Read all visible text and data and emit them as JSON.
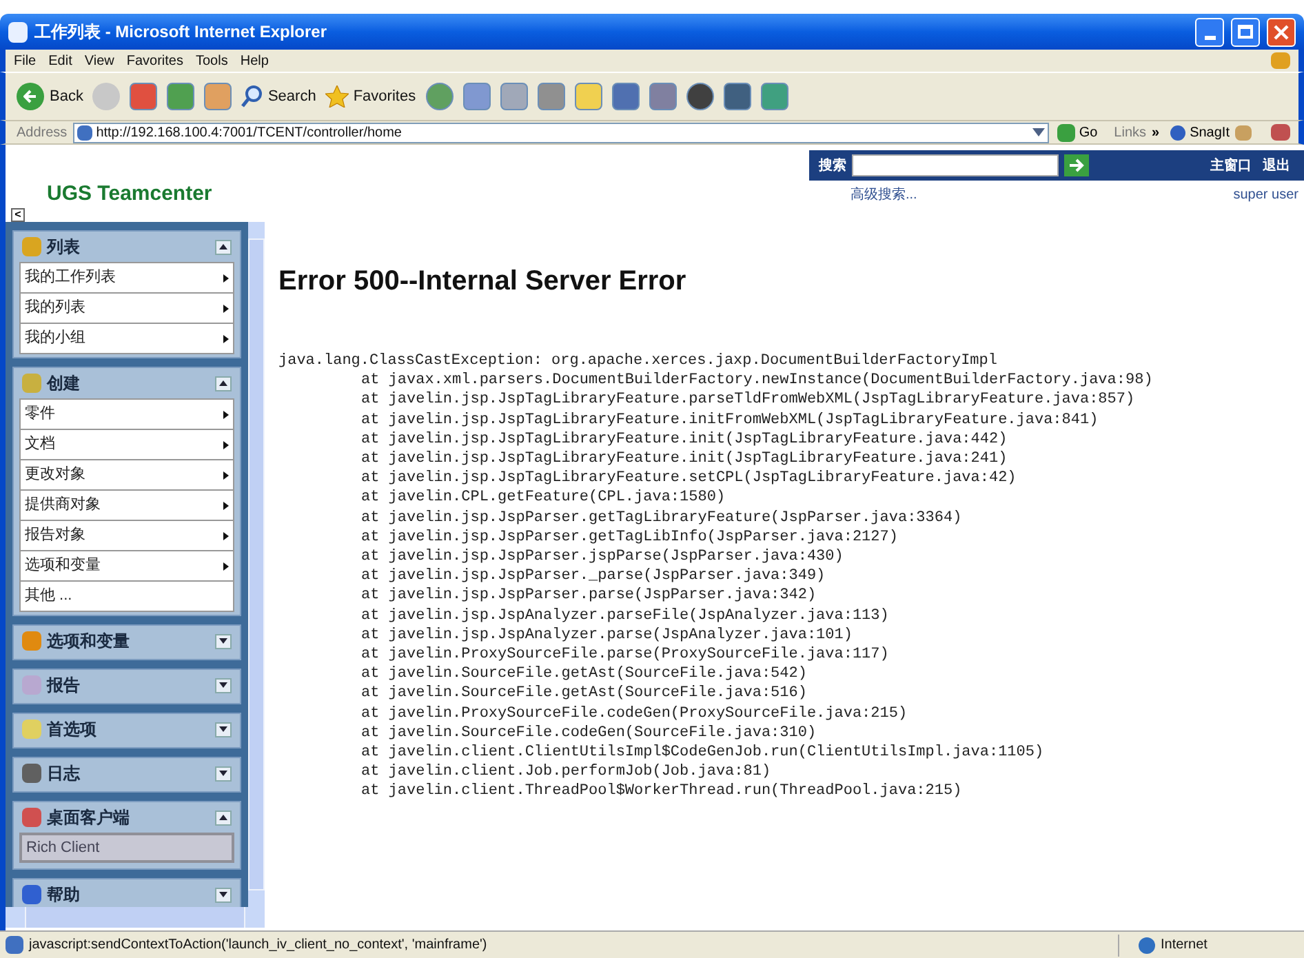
{
  "window": {
    "title": "工作列表 - Microsoft Internet Explorer"
  },
  "menu": [
    "File",
    "Edit",
    "View",
    "Favorites",
    "Tools",
    "Help"
  ],
  "toolbar": {
    "back": "Back",
    "search": "Search",
    "favorites": "Favorites"
  },
  "address_bar": {
    "label": "Address",
    "url": "http://192.168.100.4:7001/TCENT/controller/home",
    "go": "Go",
    "links": "Links",
    "links_more": "»",
    "snagit": "SnagIt"
  },
  "header": {
    "logo": "UGS Teamcenter",
    "search_label": "搜索",
    "advanced_search": "高级搜索...",
    "home": "主窗口",
    "logout": "退出",
    "user": "super user",
    "collapse": "<"
  },
  "sidebar": [
    {
      "title": "列表",
      "expanded": true,
      "items": [
        {
          "label": "我的工作列表",
          "kind": "menu"
        },
        {
          "label": "我的列表",
          "kind": "menu"
        },
        {
          "label": "我的小组",
          "kind": "menu"
        }
      ]
    },
    {
      "title": "创建",
      "expanded": true,
      "items": [
        {
          "label": "零件",
          "kind": "menu"
        },
        {
          "label": "文档",
          "kind": "menu"
        },
        {
          "label": "更改对象",
          "kind": "menu"
        },
        {
          "label": "提供商对象",
          "kind": "menu"
        },
        {
          "label": "报告对象",
          "kind": "menu"
        },
        {
          "label": "选项和变量",
          "kind": "menu"
        },
        {
          "label": "其他 ...",
          "kind": "link"
        }
      ]
    },
    {
      "title": "选项和变量",
      "expanded": false
    },
    {
      "title": "报告",
      "expanded": false
    },
    {
      "title": "首选项",
      "expanded": false
    },
    {
      "title": "日志",
      "expanded": false
    },
    {
      "title": "桌面客户端",
      "expanded": true,
      "items": [
        {
          "label": "Rich Client",
          "kind": "button"
        }
      ]
    },
    {
      "title": "帮助",
      "expanded": false
    }
  ],
  "error": {
    "heading": "Error 500--Internal Server Error",
    "exception": "java.lang.ClassCastException: org.apache.xerces.jaxp.DocumentBuilderFactoryImpl",
    "frames": [
      "at javax.xml.parsers.DocumentBuilderFactory.newInstance(DocumentBuilderFactory.java:98)",
      "at javelin.jsp.JspTagLibraryFeature.parseTldFromWebXML(JspTagLibraryFeature.java:857)",
      "at javelin.jsp.JspTagLibraryFeature.initFromWebXML(JspTagLibraryFeature.java:841)",
      "at javelin.jsp.JspTagLibraryFeature.init(JspTagLibraryFeature.java:442)",
      "at javelin.jsp.JspTagLibraryFeature.init(JspTagLibraryFeature.java:241)",
      "at javelin.jsp.JspTagLibraryFeature.setCPL(JspTagLibraryFeature.java:42)",
      "at javelin.CPL.getFeature(CPL.java:1580)",
      "at javelin.jsp.JspParser.getTagLibraryFeature(JspParser.java:3364)",
      "at javelin.jsp.JspParser.getTagLibInfo(JspParser.java:2127)",
      "at javelin.jsp.JspParser.jspParse(JspParser.java:430)",
      "at javelin.jsp.JspParser._parse(JspParser.java:349)",
      "at javelin.jsp.JspParser.parse(JspParser.java:342)",
      "at javelin.jsp.JspAnalyzer.parseFile(JspAnalyzer.java:113)",
      "at javelin.jsp.JspAnalyzer.parse(JspAnalyzer.java:101)",
      "at javelin.ProxySourceFile.parse(ProxySourceFile.java:117)",
      "at javelin.SourceFile.getAst(SourceFile.java:542)",
      "at javelin.SourceFile.getAst(SourceFile.java:516)",
      "at javelin.ProxySourceFile.codeGen(ProxySourceFile.java:215)",
      "at javelin.SourceFile.codeGen(SourceFile.java:310)",
      "at javelin.client.ClientUtilsImpl$CodeGenJob.run(ClientUtilsImpl.java:1105)",
      "at javelin.client.Job.performJob(Job.java:81)",
      "at javelin.client.ThreadPool$WorkerThread.run(ThreadPool.java:215)"
    ]
  },
  "status_bar": {
    "text": "javascript:sendContextToAction('launch_iv_client_no_context', 'mainframe')",
    "zone": "Internet"
  }
}
